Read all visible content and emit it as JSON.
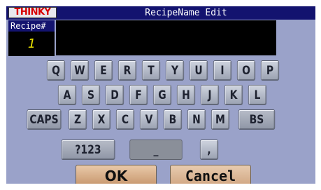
{
  "header": {
    "logo_text": "THINKY",
    "title": "RecipeName Edit"
  },
  "recipe": {
    "label": "Recipe#",
    "number": "1"
  },
  "name_field": {
    "value": ""
  },
  "keyboard": {
    "row1": [
      "Q",
      "W",
      "E",
      "R",
      "T",
      "Y",
      "U",
      "I",
      "O",
      "P"
    ],
    "row2": [
      "A",
      "S",
      "D",
      "F",
      "G",
      "H",
      "J",
      "K",
      "L"
    ],
    "row3": [
      "CAPS",
      "Z",
      "X",
      "C",
      "V",
      "B",
      "N",
      "M",
      "BS"
    ],
    "row4": {
      "numbers": "?123",
      "space": "_",
      "comma": ","
    }
  },
  "buttons": {
    "ok": "OK",
    "cancel": "Cancel"
  },
  "colors": {
    "background": "#9aa2c9",
    "title_bar": "#13136f",
    "logo_text": "#d80000",
    "recipe_number": "#e8e000",
    "ok_button": "#d8aa80",
    "cancel_button": "#dcb48f"
  }
}
